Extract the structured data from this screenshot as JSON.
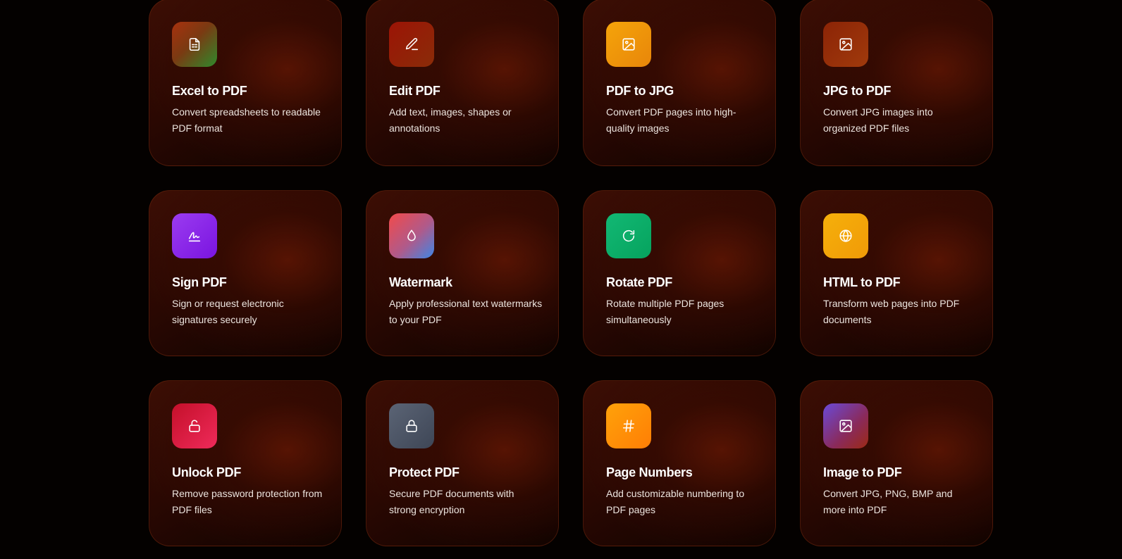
{
  "tools": [
    {
      "id": "excel-to-pdf",
      "title": "Excel to PDF",
      "description": "Convert spreadsheets to readable PDF format",
      "icon": "spreadsheet-file-icon"
    },
    {
      "id": "edit-pdf",
      "title": "Edit PDF",
      "description": "Add text, images, shapes or annotations",
      "icon": "pencil-icon"
    },
    {
      "id": "pdf-to-jpg",
      "title": "PDF to JPG",
      "description": "Convert PDF pages into high-quality images",
      "icon": "image-icon"
    },
    {
      "id": "jpg-to-pdf",
      "title": "JPG to PDF",
      "description": "Convert JPG images into organized PDF files",
      "icon": "image-icon"
    },
    {
      "id": "sign-pdf",
      "title": "Sign PDF",
      "description": "Sign or request electronic signatures securely",
      "icon": "signature-icon"
    },
    {
      "id": "watermark",
      "title": "Watermark",
      "description": "Apply professional text watermarks to your PDF",
      "icon": "droplet-icon"
    },
    {
      "id": "rotate-pdf",
      "title": "Rotate PDF",
      "description": "Rotate multiple PDF pages simultaneously",
      "icon": "rotate-icon"
    },
    {
      "id": "html-to-pdf",
      "title": "HTML to PDF",
      "description": "Transform web pages into PDF documents",
      "icon": "globe-icon"
    },
    {
      "id": "unlock-pdf",
      "title": "Unlock PDF",
      "description": "Remove password protection from PDF files",
      "icon": "unlock-icon"
    },
    {
      "id": "protect-pdf",
      "title": "Protect PDF",
      "description": "Secure PDF documents with strong encryption",
      "icon": "lock-icon"
    },
    {
      "id": "page-numbers",
      "title": "Page Numbers",
      "description": "Add customizable numbering to PDF pages",
      "icon": "hash-icon"
    },
    {
      "id": "image-to-pdf",
      "title": "Image to PDF",
      "description": "Convert JPG, PNG, BMP and more into PDF",
      "icon": "image-icon"
    }
  ],
  "colors": {
    "page_background": "#040100",
    "card_background": "#2a0802",
    "title_text": "#ffffff",
    "description_text": "#ece4df"
  }
}
